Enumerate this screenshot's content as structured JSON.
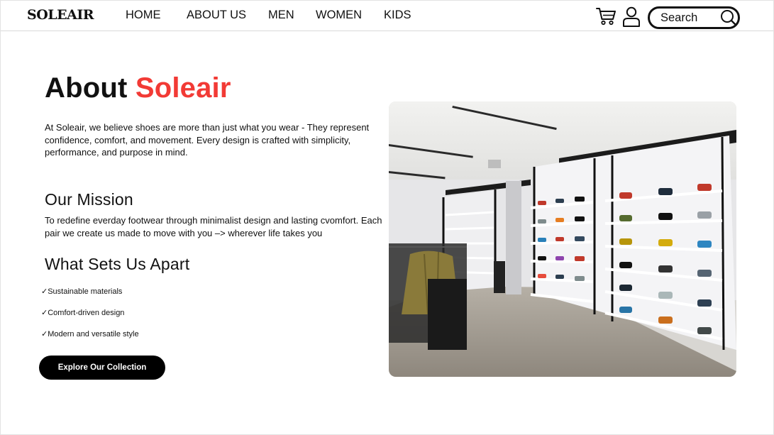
{
  "brand": {
    "logo": "SOLEAIR"
  },
  "nav": {
    "items": [
      {
        "label": "HOME"
      },
      {
        "label": "ABOUT US"
      },
      {
        "label": "MEN"
      },
      {
        "label": "WOMEN"
      },
      {
        "label": "KIDS"
      }
    ]
  },
  "header": {
    "cart_icon": "cart-icon",
    "user_icon": "user-icon",
    "search": {
      "placeholder": "Search",
      "icon": "search-icon"
    }
  },
  "about": {
    "title_prefix": "About",
    "title_accent": "Soleair",
    "accent_color": "#f23a35",
    "intro": "At Soleair, we believe shoes are more than just what you wear - They represent confidence, comfort, and movement. Every design is crafted with simplicity, performance, and purpose in mind."
  },
  "mission": {
    "title": "Our Mission",
    "text": "To redefine everday footwear through minimalist design and lasting cvomfort. Each pair we create us made to move with you –> wherever life takes you"
  },
  "apart": {
    "title": "What Sets Us Apart",
    "features": [
      {
        "label": "✓Sustainable materials"
      },
      {
        "label": "✓Comfort-driven design"
      },
      {
        "label": "✓Modern and versatile style"
      }
    ]
  },
  "cta": {
    "label": "Explore Our Collection",
    "background": "#000000"
  },
  "image": {
    "subject": "store-interior-shoe-wall-photo"
  }
}
